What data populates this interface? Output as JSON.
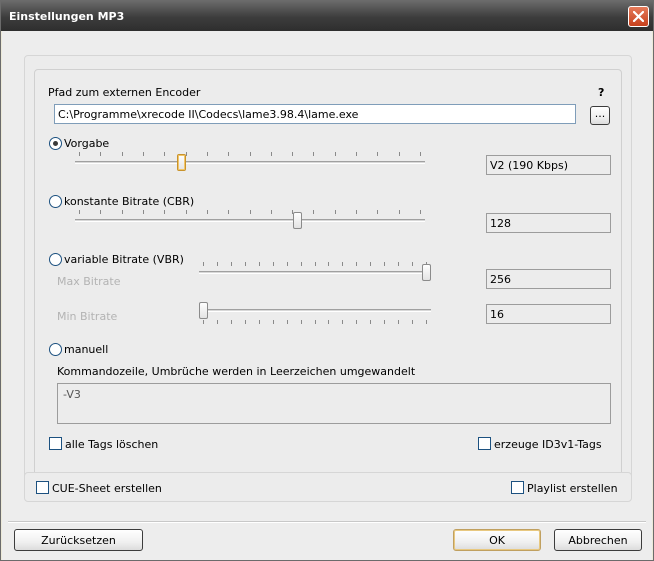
{
  "window": {
    "title": "Einstellungen MP3"
  },
  "encoder": {
    "label": "Pfad zum externen Encoder",
    "help": "?",
    "path_value": "C:\\Programme\\xrecode II\\Codecs\\lame3.98.4\\lame.exe",
    "browse_label": "..."
  },
  "preset": {
    "label": "Vorgabe",
    "selected": true,
    "value_text": "V2 (190 Kbps)",
    "slider_level": 0.3
  },
  "cbr": {
    "label": "konstante Bitrate (CBR)",
    "selected": false,
    "value_text": "128",
    "slider_level": 0.64
  },
  "vbr": {
    "label": "variable Bitrate (VBR)",
    "selected": false,
    "max_label": "Max Bitrate",
    "max_value": "256",
    "max_level": 1.0,
    "min_label": "Min Bitrate",
    "min_value": "16",
    "min_level": 0.0
  },
  "manual": {
    "label": "manuell",
    "selected": false,
    "cmd_label": "Kommandozeile, Umbrüche werden in Leerzeichen umgewandelt",
    "cmd_value": "-V3"
  },
  "options": {
    "delete_tags_label": "alle Tags löschen",
    "delete_tags_checked": false,
    "id3v1_label": "erzeuge ID3v1-Tags",
    "id3v1_checked": false,
    "cue_label": "CUE-Sheet erstellen",
    "cue_checked": false,
    "playlist_label": "Playlist erstellen",
    "playlist_checked": false
  },
  "buttons": {
    "reset_label": "Zurücksetzen",
    "ok_label": "OK",
    "cancel_label": "Abbrechen"
  }
}
